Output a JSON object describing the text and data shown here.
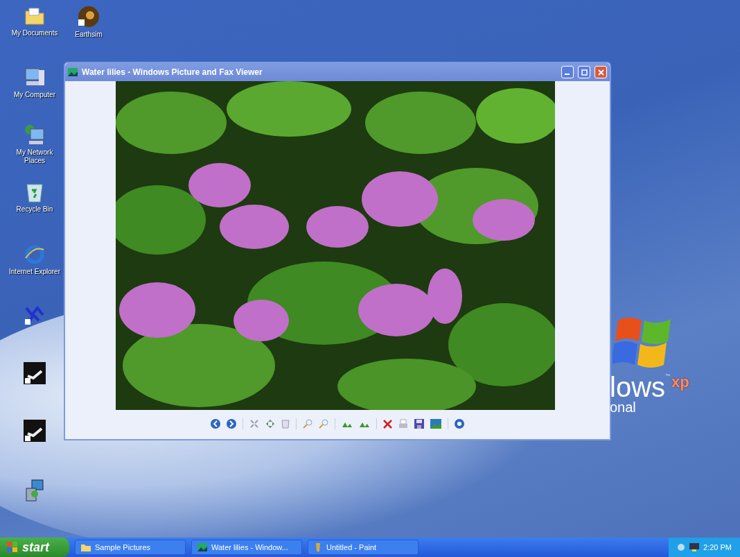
{
  "desktop_icons": [
    {
      "label": "My Documents"
    },
    {
      "label": "Earthsim"
    },
    {
      "label": "My Computer"
    },
    {
      "label": "My Network Places"
    },
    {
      "label": "Recycle Bin"
    },
    {
      "label": "Internet Explorer"
    }
  ],
  "window": {
    "title": "Water lilies - Windows Picture and Fax Viewer"
  },
  "wallpaper_logo": {
    "word": "lows",
    "edition": "xp",
    "trademark": "™",
    "subtitle": "onal"
  },
  "taskbar": {
    "start": "start",
    "buttons": [
      {
        "label": "Sample Pictures"
      },
      {
        "label": "Water lilies - Window..."
      },
      {
        "label": "Untitled - Paint"
      }
    ],
    "clock": "2:20 PM"
  }
}
